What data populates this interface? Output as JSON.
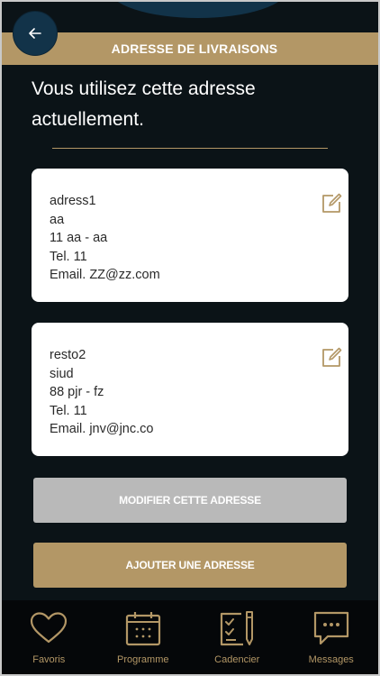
{
  "header": {
    "title": "ADRESSE DE LIVRAISONS",
    "back_icon": "arrow-left-icon"
  },
  "intro_text": "Vous utilisez cette adresse actuellement.",
  "addresses": [
    {
      "name": "adress1",
      "line2": "aa",
      "city": "11 aa - aa",
      "tel": "Tel. 11",
      "email": "Email. ZZ@zz.com",
      "edit_icon": "edit-icon"
    },
    {
      "name": "resto2",
      "line2": "siud",
      "city": "88 pjr - fz",
      "tel": "Tel. 11",
      "email": "Email. jnv@jnc.co",
      "edit_icon": "edit-icon"
    }
  ],
  "buttons": {
    "modify": "MODIFIER CETTE ADRESSE",
    "add": "AJOUTER UNE ADRESSE"
  },
  "tabs": [
    {
      "label": "Favoris",
      "icon": "heart-icon"
    },
    {
      "label": "Programme",
      "icon": "calendar-icon"
    },
    {
      "label": "Cadencier",
      "icon": "checklist-icon"
    },
    {
      "label": "Messages",
      "icon": "chat-icon"
    }
  ],
  "colors": {
    "background": "#0b1317",
    "accent_gold": "#b39766",
    "navy": "#123349",
    "disabled_gray": "#b9b9b9",
    "card": "#ffffff"
  }
}
